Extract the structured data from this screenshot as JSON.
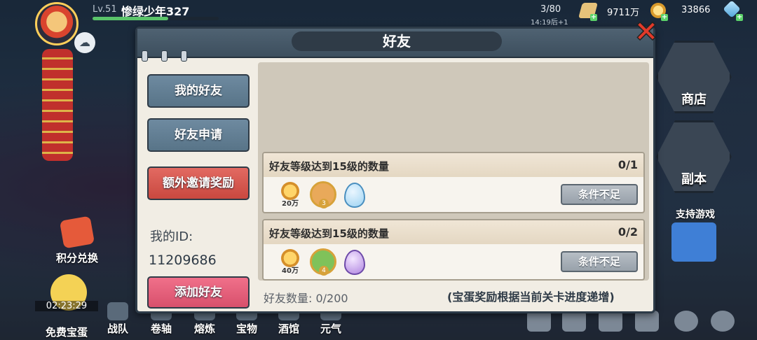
{
  "player": {
    "level": "Lv.51",
    "name": "惨绿少年327",
    "xp_fraction": 0.6
  },
  "resources": {
    "stamina": "3/80",
    "stamina_timer": "14:19后+1",
    "gold": "9711万",
    "gems": "33866"
  },
  "left_side": {
    "points_exchange": "积分兑换",
    "free_egg_timer": "02:23:29",
    "free_egg": "免费宝蛋"
  },
  "bottom_nav": [
    "战队",
    "卷轴",
    "熔炼",
    "宝物",
    "酒馆",
    "元气"
  ],
  "right_side": {
    "shop": "商店",
    "dungeon": "副本",
    "support": "支持游戏"
  },
  "dialog": {
    "title": "好友",
    "tabs": {
      "my_friends": "我的好友",
      "friend_requests": "好友申请",
      "invite_rewards": "额外邀请奖励"
    },
    "my_id_label": "我的ID:",
    "my_id_value": "11209686",
    "add_friend": "添加好友",
    "tasks": [
      {
        "title": "好友等级达到15级的数量",
        "count": "0/1",
        "coin_amount": "20万",
        "hero_level": "3",
        "button": "条件不足"
      },
      {
        "title": "好友等级达到15级的数量",
        "count": "0/2",
        "coin_amount": "40万",
        "hero_level": "4",
        "button": "条件不足"
      }
    ],
    "friend_count": "好友数量: 0/200",
    "note": "(宝蛋奖励根据当前关卡进度递增)"
  },
  "colors": {
    "accent_red": "#e23a2a",
    "tab_blue": "#6e8aa0",
    "tab_red": "#e26a62",
    "tab_pink": "#f0708a",
    "disabled_button": "#98a1aa"
  }
}
